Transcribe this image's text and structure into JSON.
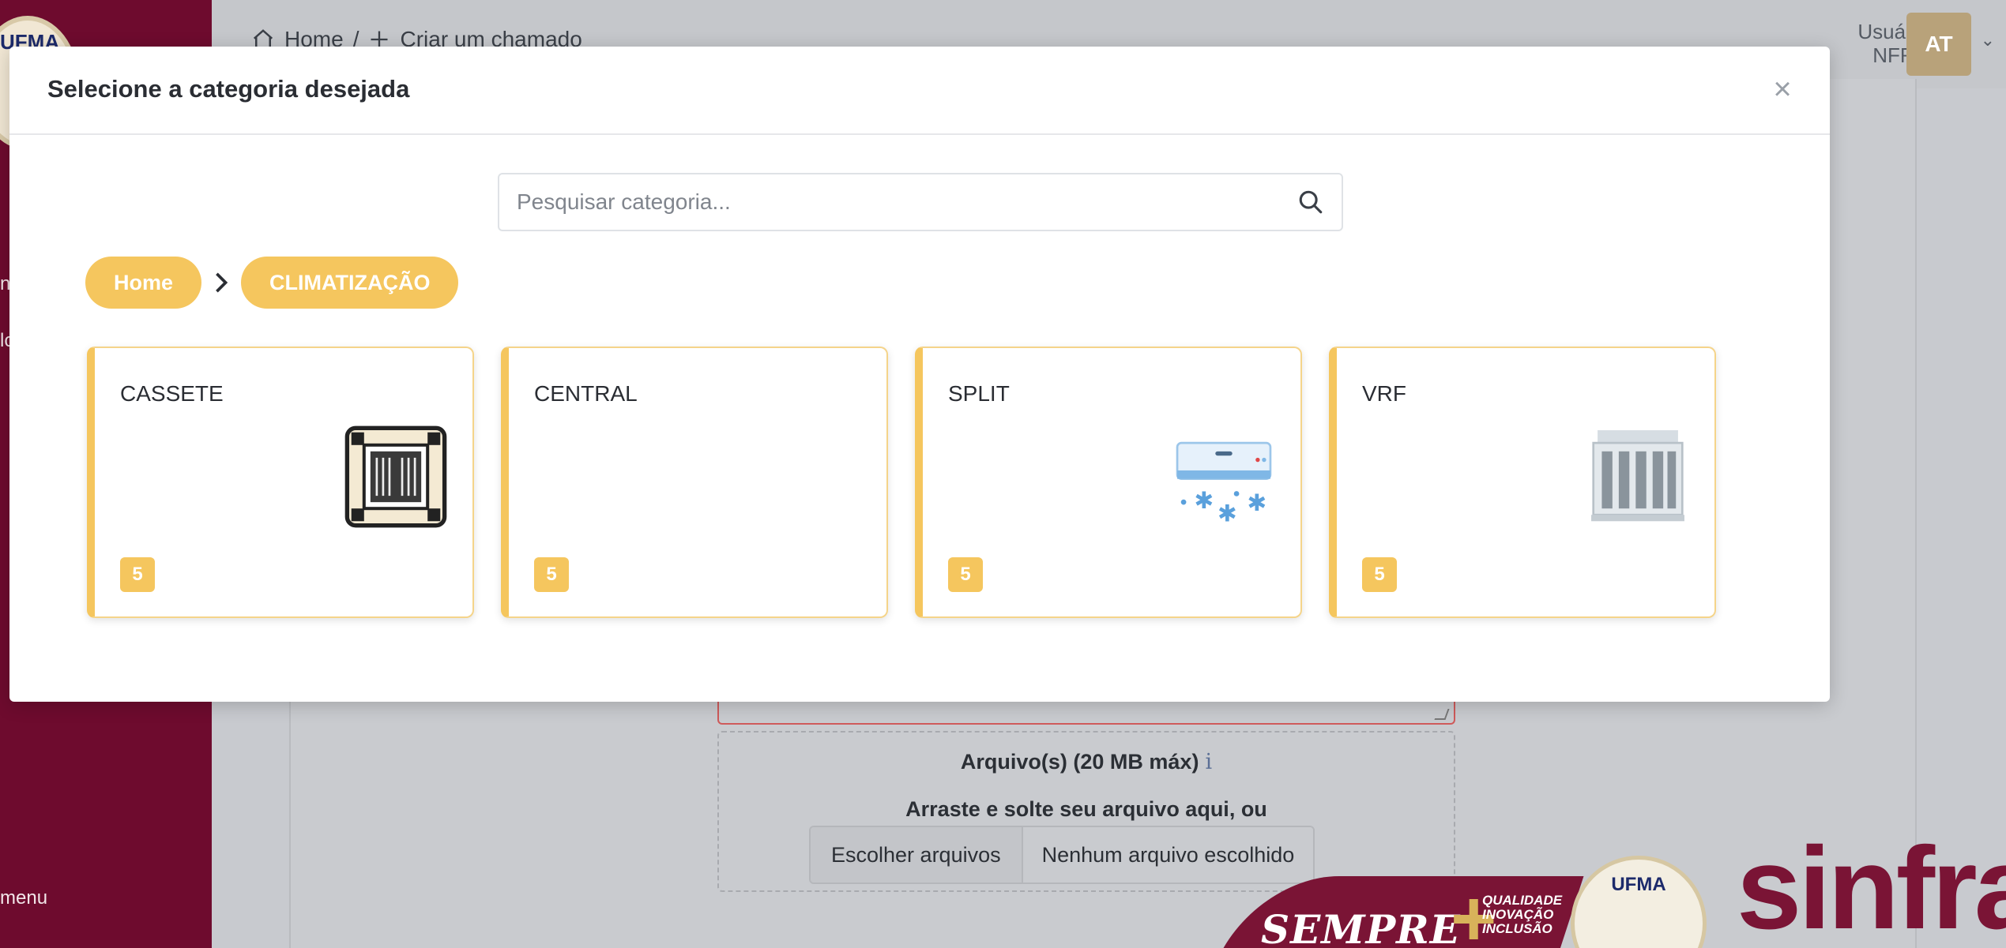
{
  "background": {
    "sidebar": {
      "logo_text": "UFMA",
      "frag_1": "n",
      "frag_2": "lo",
      "menu_label": "menu"
    },
    "breadcrumb": {
      "home": "Home",
      "separator": "/",
      "current": "Criar um chamado"
    },
    "user": {
      "label": "Usuário",
      "org": "NFRA",
      "initials": "AT"
    },
    "upload": {
      "title": "Arquivo(s) (20 MB máx)",
      "info_glyph": "i",
      "drag_text": "Arraste e solte seu arquivo aqui, ou",
      "choose_button": "Escolher arquivos",
      "no_file_text": "Nenhum arquivo escolhido"
    },
    "brand": {
      "sempre": "SEMPRE",
      "tags": [
        "QUALIDADE",
        "INOVAÇÃO",
        "INCLUSÃO"
      ],
      "seal_text": "UFMA",
      "sinfra": "sinfra"
    }
  },
  "modal": {
    "title": "Selecione a categoria desejada",
    "search": {
      "placeholder": "Pesquisar categoria..."
    },
    "breadcrumbs": [
      "Home",
      "CLIMATIZAÇÃO"
    ],
    "categories": [
      {
        "name": "CASSETE",
        "count": "5",
        "icon": "cassette-ac-icon"
      },
      {
        "name": "CENTRAL",
        "count": "5",
        "icon": ""
      },
      {
        "name": "SPLIT",
        "count": "5",
        "icon": "split-ac-icon"
      },
      {
        "name": "VRF",
        "count": "5",
        "icon": "vrf-unit-icon"
      }
    ]
  },
  "colors": {
    "accent": "#f5c65e",
    "sidebar": "#6e0b2e",
    "brand": "#7a1435"
  }
}
